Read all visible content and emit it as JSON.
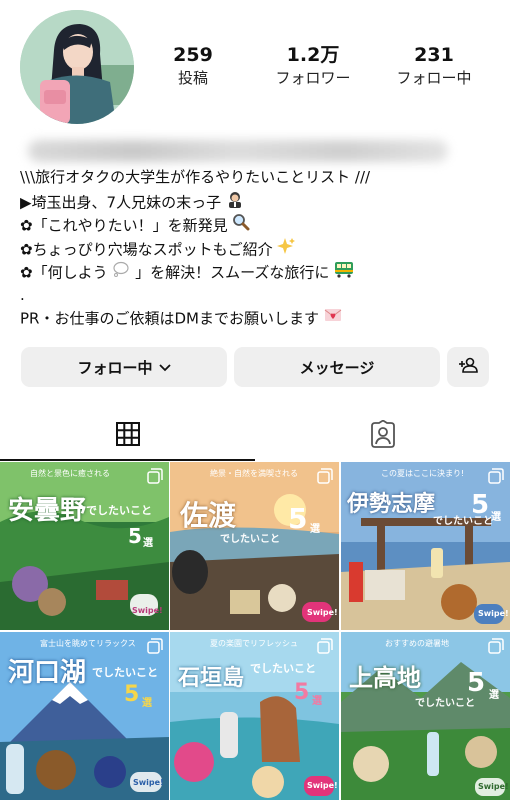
{
  "stats": {
    "posts": {
      "value": "259",
      "label": "投稿"
    },
    "followers": {
      "value": "1.2万",
      "label": "フォロワー"
    },
    "following": {
      "value": "231",
      "label": "フォロー中"
    }
  },
  "bio": {
    "line1": "\\\\\\旅行オタクの大学生が作るやりたいことリスト ///",
    "line2": "▶埼玉出身、7人兄妹の末っ子",
    "line3": "✿「これやりたい！」を新発見",
    "line4": "✿ちょっぴり穴場なスポットもご紹介",
    "line5": "✿「何しよう",
    "line5b": "」を解決！スムーズな旅行に",
    "line6": ".",
    "line7": "PR・お仕事のご依頼はDMまでお願いします"
  },
  "buttons": {
    "following": "フォロー中",
    "message": "メッセージ"
  },
  "posts": [
    {
      "title": "安曇野",
      "sub": "でしたいこと",
      "num": "5",
      "unit": "選",
      "top": "自然と景色に癒される",
      "swipe": "Swipe!"
    },
    {
      "title": "佐渡",
      "sub": "でしたいこと",
      "num": "5",
      "unit": "選",
      "top": "絶景・自然を満喫される",
      "swipe": "Swipe!"
    },
    {
      "title": "伊勢志摩",
      "sub": "でしたいこと",
      "num": "5",
      "unit": "選",
      "top": "この夏はここに決まり!",
      "swipe": "Swipe!"
    },
    {
      "title": "河口湖",
      "sub": "でしたいこと",
      "num": "5",
      "unit": "選",
      "top": "富士山を眺めてリラックス",
      "swipe": "Swipe!"
    },
    {
      "title": "石垣島",
      "sub": "でしたいこと",
      "num": "5",
      "unit": "選",
      "top": "夏の楽園でリフレッシュ",
      "swipe": "Swipe!"
    },
    {
      "title": "上高地",
      "sub": "でしたいこと",
      "num": "5",
      "unit": "選",
      "top": "おすすめの避暑地",
      "swipe": "Swipe!"
    }
  ]
}
